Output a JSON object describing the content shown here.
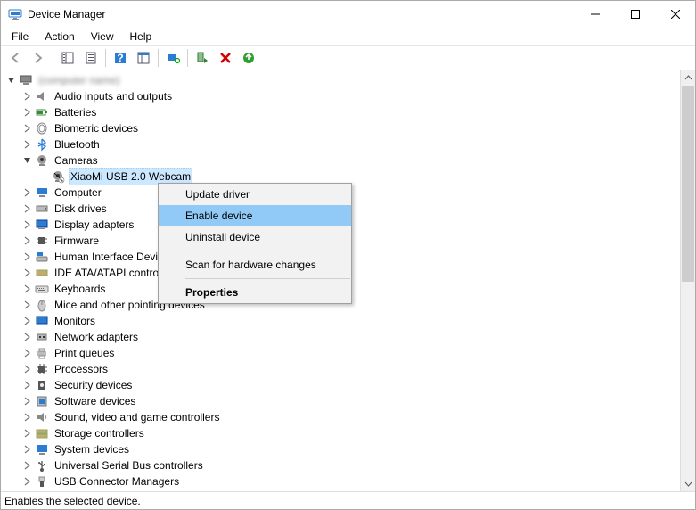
{
  "titlebar": {
    "title": "Device Manager"
  },
  "menubar": {
    "file": "File",
    "action": "Action",
    "view": "View",
    "help": "Help"
  },
  "tree": {
    "root": "(computer name)",
    "cat_audio": "Audio inputs and outputs",
    "cat_batt": "Batteries",
    "cat_bio": "Biometric devices",
    "cat_bt": "Bluetooth",
    "cat_cam": "Cameras",
    "dev_cam_1": "XiaoMi USB 2.0 Webcam",
    "cat_comp": "Computer",
    "cat_disk": "Disk drives",
    "cat_disp": "Display adapters",
    "cat_fw": "Firmware",
    "cat_hid": "Human Interface Devices",
    "cat_ide": "IDE ATA/ATAPI controllers",
    "cat_kb": "Keyboards",
    "cat_mouse": "Mice and other pointing devices",
    "cat_mon": "Monitors",
    "cat_net": "Network adapters",
    "cat_print": "Print queues",
    "cat_proc": "Processors",
    "cat_sec": "Security devices",
    "cat_sd": "Software devices",
    "cat_sound": "Sound, video and game controllers",
    "cat_stor": "Storage controllers",
    "cat_sys": "System devices",
    "cat_usb": "Universal Serial Bus controllers",
    "cat_usbc": "USB Connector Managers"
  },
  "context_menu": {
    "update_driver": "Update driver",
    "enable_device": "Enable device",
    "uninstall_device": "Uninstall device",
    "scan": "Scan for hardware changes",
    "properties": "Properties"
  },
  "statusbar": {
    "text": "Enables the selected device."
  }
}
